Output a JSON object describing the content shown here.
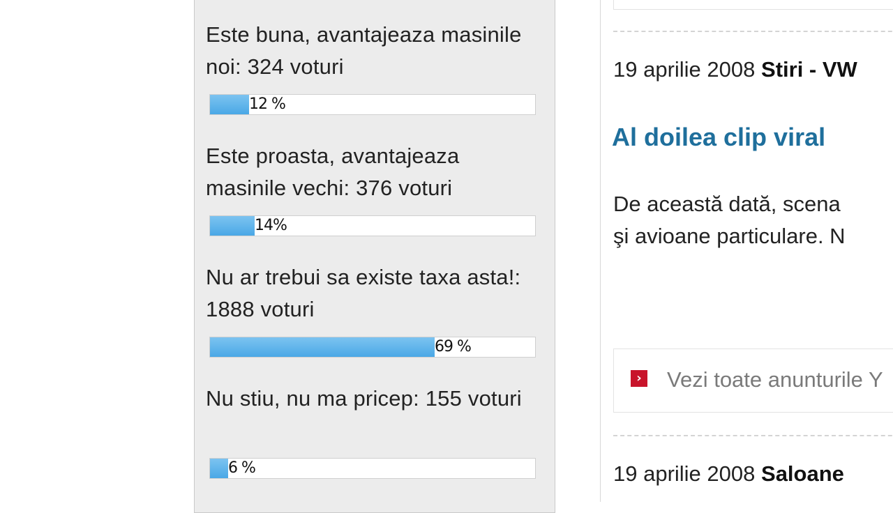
{
  "poll": {
    "options": [
      {
        "text": "Este buna, avantajeaza masinile noi: 324 voturi",
        "percent_label": "12 %",
        "percent": 12
      },
      {
        "text": "Este proasta, avantajeaza masinile vechi: 376 voturi",
        "percent_label": "14%",
        "percent": 14
      },
      {
        "text": "Nu ar trebui sa existe taxa asta!: 1888 voturi",
        "percent_label": "69 %",
        "percent": 69
      },
      {
        "text": "Nu stiu, nu ma pricep: 155 voturi",
        "percent_label": "6 %",
        "percent": 6
      }
    ]
  },
  "news": [
    {
      "date": "19 aprilie 2008",
      "category": "Stiri - VW"
    },
    {
      "date": "19 aprilie 2008",
      "category": "Saloane"
    }
  ],
  "article": {
    "title": "Al doilea clip viral",
    "body_line1": "De această dată, scena",
    "body_line2": "şi avioane particulare. N"
  },
  "ads": {
    "link": "Vezi toate anunturile Y",
    "icon": "red-arrow-icon"
  },
  "colors": {
    "bar_fill": "#4aa8e6",
    "title": "#1f6f9c",
    "ads_icon": "#c8142b"
  }
}
